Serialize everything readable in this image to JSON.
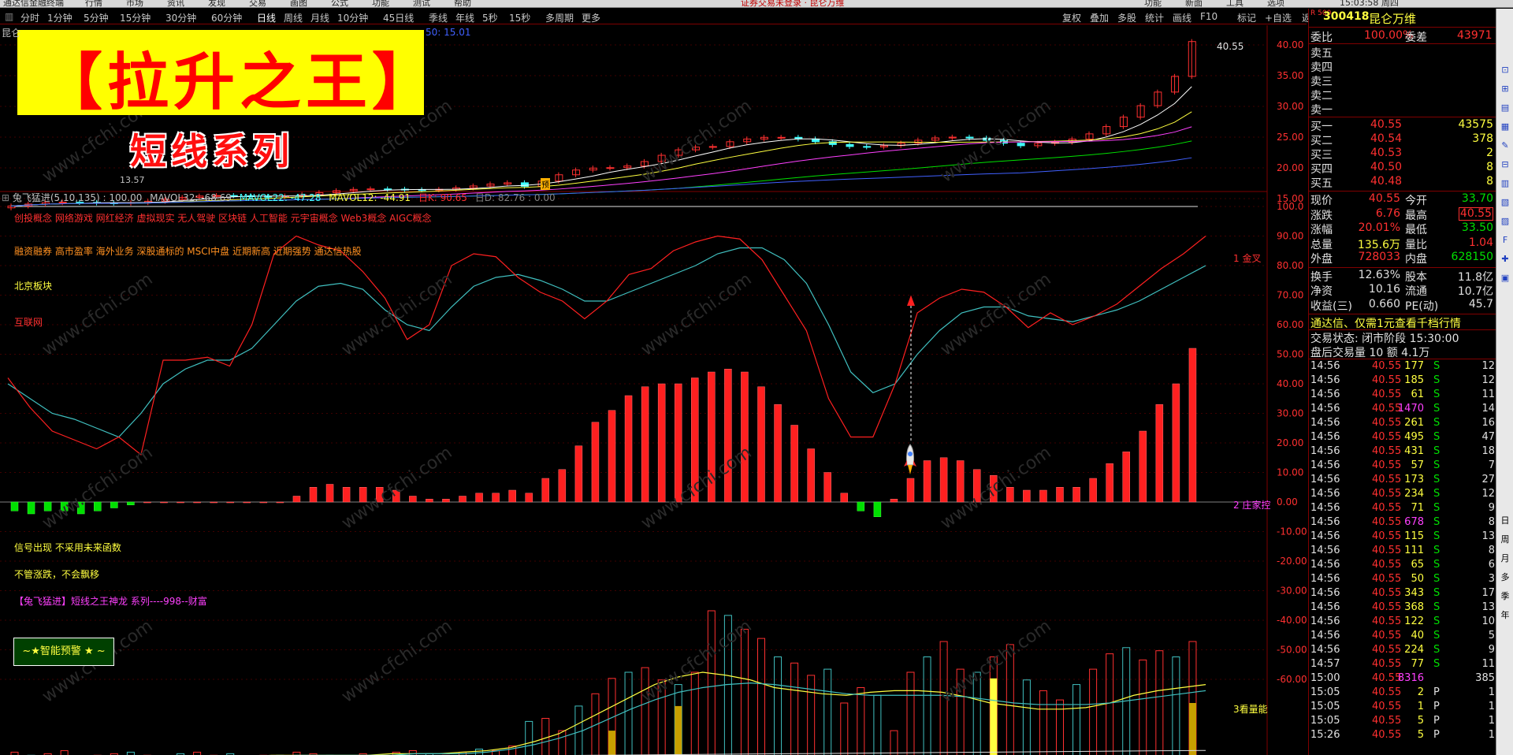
{
  "menu": {
    "items": [
      "通达信金融终端",
      "行情",
      "市场",
      "资讯",
      "发现",
      "交易",
      "画图",
      "公式",
      "功能",
      "测试",
      "帮助"
    ],
    "notice": "证券交易未登录 · 昆仑万维",
    "right_items": [
      "功能",
      "新面",
      "工具",
      "选项"
    ],
    "clock": "15:03:58 周四"
  },
  "toolbar": {
    "periods": [
      "分时",
      "1分钟",
      "5分钟",
      "15分钟",
      "30分钟",
      "60分钟",
      "日线",
      "周线",
      "月线",
      "10分钟",
      "45日线",
      "季线",
      "年线",
      "5秒",
      "15秒",
      "多周期",
      "更多"
    ],
    "active": "日线",
    "right_tools": [
      "复权",
      "叠加",
      "多股",
      "统计",
      "画线",
      "F10",
      "标记",
      "+自选",
      "返回"
    ]
  },
  "banner": {
    "title": "【拉升之王】",
    "subtitle": "短线系列",
    "watermark": "www.cfchi.com"
  },
  "main_chart": {
    "stock_short": "昆仑",
    "ma_fragment": "50: 15.01",
    "price_high_label": "40.55",
    "price_low_label": "13.57",
    "event_tag": "预",
    "y_labels": [
      "40.00",
      "35.00",
      "30.00",
      "25.00",
      "20.00",
      "15.00"
    ]
  },
  "indicator": {
    "header_name": "兔飞猛进(5,10,135) : 100.00",
    "header_mavol32": "MAVOL32: -68.69",
    "header_mavol22": "MAVOL22: -47.28",
    "header_mavol12": "MAVOL12: -44.91",
    "header_k": "日K: 90.65",
    "header_d": "日D: 82.76 : 0.00",
    "concepts_line1": "创投概念 网络游戏 网红经济 虚拟现实 无人驾驶 区块链 人工智能 元宇宙概念 Web3概念 AIGC概念",
    "concepts_line2": "融资融券 高市盈率 海外业务 深股通标的 MSCI中盘 近期新高 近期强势 通达信热股",
    "board": "北京板块",
    "industry": "互联网",
    "note1": "信号出现  不采用未来函数",
    "note2": "不管涨跌，不会飘移",
    "series_title": "【兔飞猛进】短线之王神龙 系列----998--财富",
    "alert_button": "~★智能预警 ★ ~",
    "label_golden": "1 金叉",
    "label_zhuang": "2 庄家控",
    "label_volume": "3看量能",
    "y_labels": [
      "100.0",
      "90.00",
      "80.00",
      "70.00",
      "60.00",
      "50.00",
      "40.00",
      "30.00",
      "20.00",
      "10.00",
      "0.00",
      "-10.00",
      "-20.00",
      "-30.00",
      "-40.00",
      "-50.00",
      "-60.00"
    ]
  },
  "quote": {
    "code": "300418",
    "name": "昆仑万维",
    "badge": "R 500",
    "webi_label": "委比",
    "webi": "100.00%",
    "weicha_label": "委差",
    "weicha": "43971",
    "sells": [
      {
        "label": "卖五",
        "price": "",
        "vol": ""
      },
      {
        "label": "卖四",
        "price": "",
        "vol": ""
      },
      {
        "label": "卖三",
        "price": "",
        "vol": ""
      },
      {
        "label": "卖二",
        "price": "",
        "vol": ""
      },
      {
        "label": "卖一",
        "price": "",
        "vol": ""
      }
    ],
    "buys": [
      {
        "label": "买一",
        "price": "40.55",
        "vol": "43575"
      },
      {
        "label": "买二",
        "price": "40.54",
        "vol": "378"
      },
      {
        "label": "买三",
        "price": "40.53",
        "vol": "2"
      },
      {
        "label": "买四",
        "price": "40.50",
        "vol": "8"
      },
      {
        "label": "买五",
        "price": "40.48",
        "vol": "8"
      }
    ],
    "stats": [
      {
        "l1": "现价",
        "v1": "40.55",
        "l2": "今开",
        "v2": "33.70"
      },
      {
        "l1": "涨跌",
        "v1": "6.76",
        "l2": "最高",
        "v2": "40.55"
      },
      {
        "l1": "涨幅",
        "v1": "20.01%",
        "l2": "最低",
        "v2": "33.50"
      },
      {
        "l1": "总量",
        "v1": "135.6万",
        "l2": "量比",
        "v2": "1.04"
      },
      {
        "l1": "外盘",
        "v1": "728033",
        "l2": "内盘",
        "v2": "628150"
      }
    ],
    "stats2": [
      {
        "l1": "换手",
        "v1": "12.63%",
        "l2": "股本",
        "v2": "11.8亿"
      },
      {
        "l1": "净资",
        "v1": "10.16",
        "l2": "流通",
        "v2": "10.7亿"
      },
      {
        "l1": "收益(三)",
        "v1": "0.660",
        "l2": "PE(动)",
        "v2": "45.7"
      }
    ],
    "promo": "通达信、仅需1元查看千档行情",
    "trade_status": "交易状态: 闭市阶段 15:30:00",
    "after_hours": "盘后交易量 10 额 4.1万",
    "ticks": [
      [
        "14:56",
        "40.55",
        "177",
        "S",
        "12"
      ],
      [
        "14:56",
        "40.55",
        "185",
        "S",
        "12"
      ],
      [
        "14:56",
        "40.55",
        "61",
        "S",
        "11"
      ],
      [
        "14:56",
        "40.55",
        "1470",
        "S",
        "14"
      ],
      [
        "14:56",
        "40.55",
        "261",
        "S",
        "16"
      ],
      [
        "14:56",
        "40.55",
        "495",
        "S",
        "47"
      ],
      [
        "14:56",
        "40.55",
        "431",
        "S",
        "18"
      ],
      [
        "14:56",
        "40.55",
        "57",
        "S",
        "7"
      ],
      [
        "14:56",
        "40.55",
        "173",
        "S",
        "27"
      ],
      [
        "14:56",
        "40.55",
        "234",
        "S",
        "12"
      ],
      [
        "14:56",
        "40.55",
        "71",
        "S",
        "9"
      ],
      [
        "14:56",
        "40.55",
        "678",
        "S",
        "8"
      ],
      [
        "14:56",
        "40.55",
        "115",
        "S",
        "13"
      ],
      [
        "14:56",
        "40.55",
        "111",
        "S",
        "8"
      ],
      [
        "14:56",
        "40.55",
        "65",
        "S",
        "6"
      ],
      [
        "14:56",
        "40.55",
        "50",
        "S",
        "3"
      ],
      [
        "14:56",
        "40.55",
        "343",
        "S",
        "17"
      ],
      [
        "14:56",
        "40.55",
        "368",
        "S",
        "13"
      ],
      [
        "14:56",
        "40.55",
        "122",
        "S",
        "10"
      ],
      [
        "14:56",
        "40.55",
        "40",
        "S",
        "5"
      ],
      [
        "14:56",
        "40.55",
        "224",
        "S",
        "9"
      ],
      [
        "14:57",
        "40.55",
        "77",
        "S",
        "11"
      ],
      [
        "15:00",
        "40.55",
        "8316",
        "",
        "385"
      ],
      [
        "15:05",
        "40.55",
        "2",
        "P",
        "1"
      ],
      [
        "15:05",
        "40.55",
        "1",
        "P",
        "1"
      ],
      [
        "15:05",
        "40.55",
        "5",
        "P",
        "1"
      ],
      [
        "15:26",
        "40.55",
        "5",
        "P",
        "1"
      ]
    ]
  },
  "side_tabs": [
    "日",
    "周",
    "月",
    "多",
    "季",
    "年"
  ],
  "colors": {
    "up": "#ff3030",
    "down": "#00e0ff",
    "grid": "#800000",
    "bg": "#000000",
    "accent": "#ffff40"
  }
}
